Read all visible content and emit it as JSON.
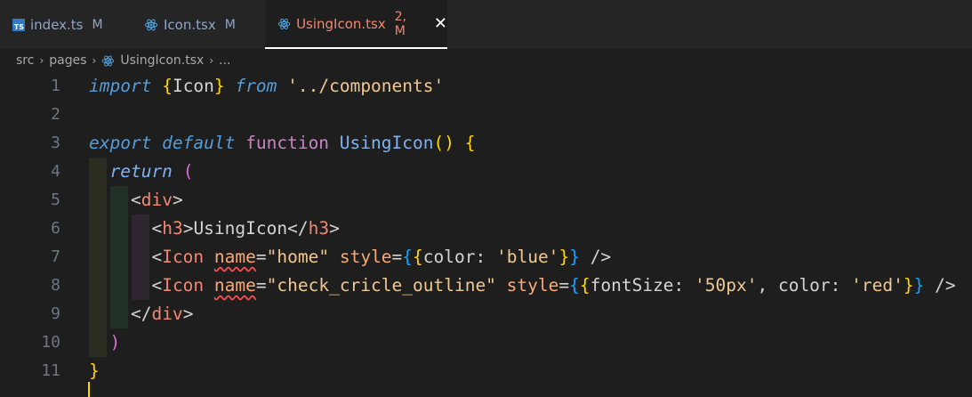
{
  "tabs": [
    {
      "label": "index.ts",
      "status": "M",
      "icon": "typescript-icon"
    },
    {
      "label": "Icon.tsx",
      "status": "M",
      "icon": "react-icon"
    },
    {
      "label": "UsingIcon.tsx",
      "status": "2, M",
      "icon": "react-icon",
      "close": "✕"
    }
  ],
  "breadcrumb": {
    "items": [
      "src",
      "pages",
      "UsingIcon.tsx",
      "..."
    ],
    "sep": "›"
  },
  "code": {
    "line_numbers": [
      "1",
      "2",
      "3",
      "4",
      "5",
      "6",
      "7",
      "8",
      "9",
      "10",
      "11"
    ]
  },
  "colors": {
    "background": "#1e1e1e",
    "tab_active_text": "#f48771",
    "keyword": "#569cd6",
    "control": "#c586c0",
    "string": "#ce9178",
    "tag": "#f48771",
    "attribute": "#f8aa7a"
  }
}
